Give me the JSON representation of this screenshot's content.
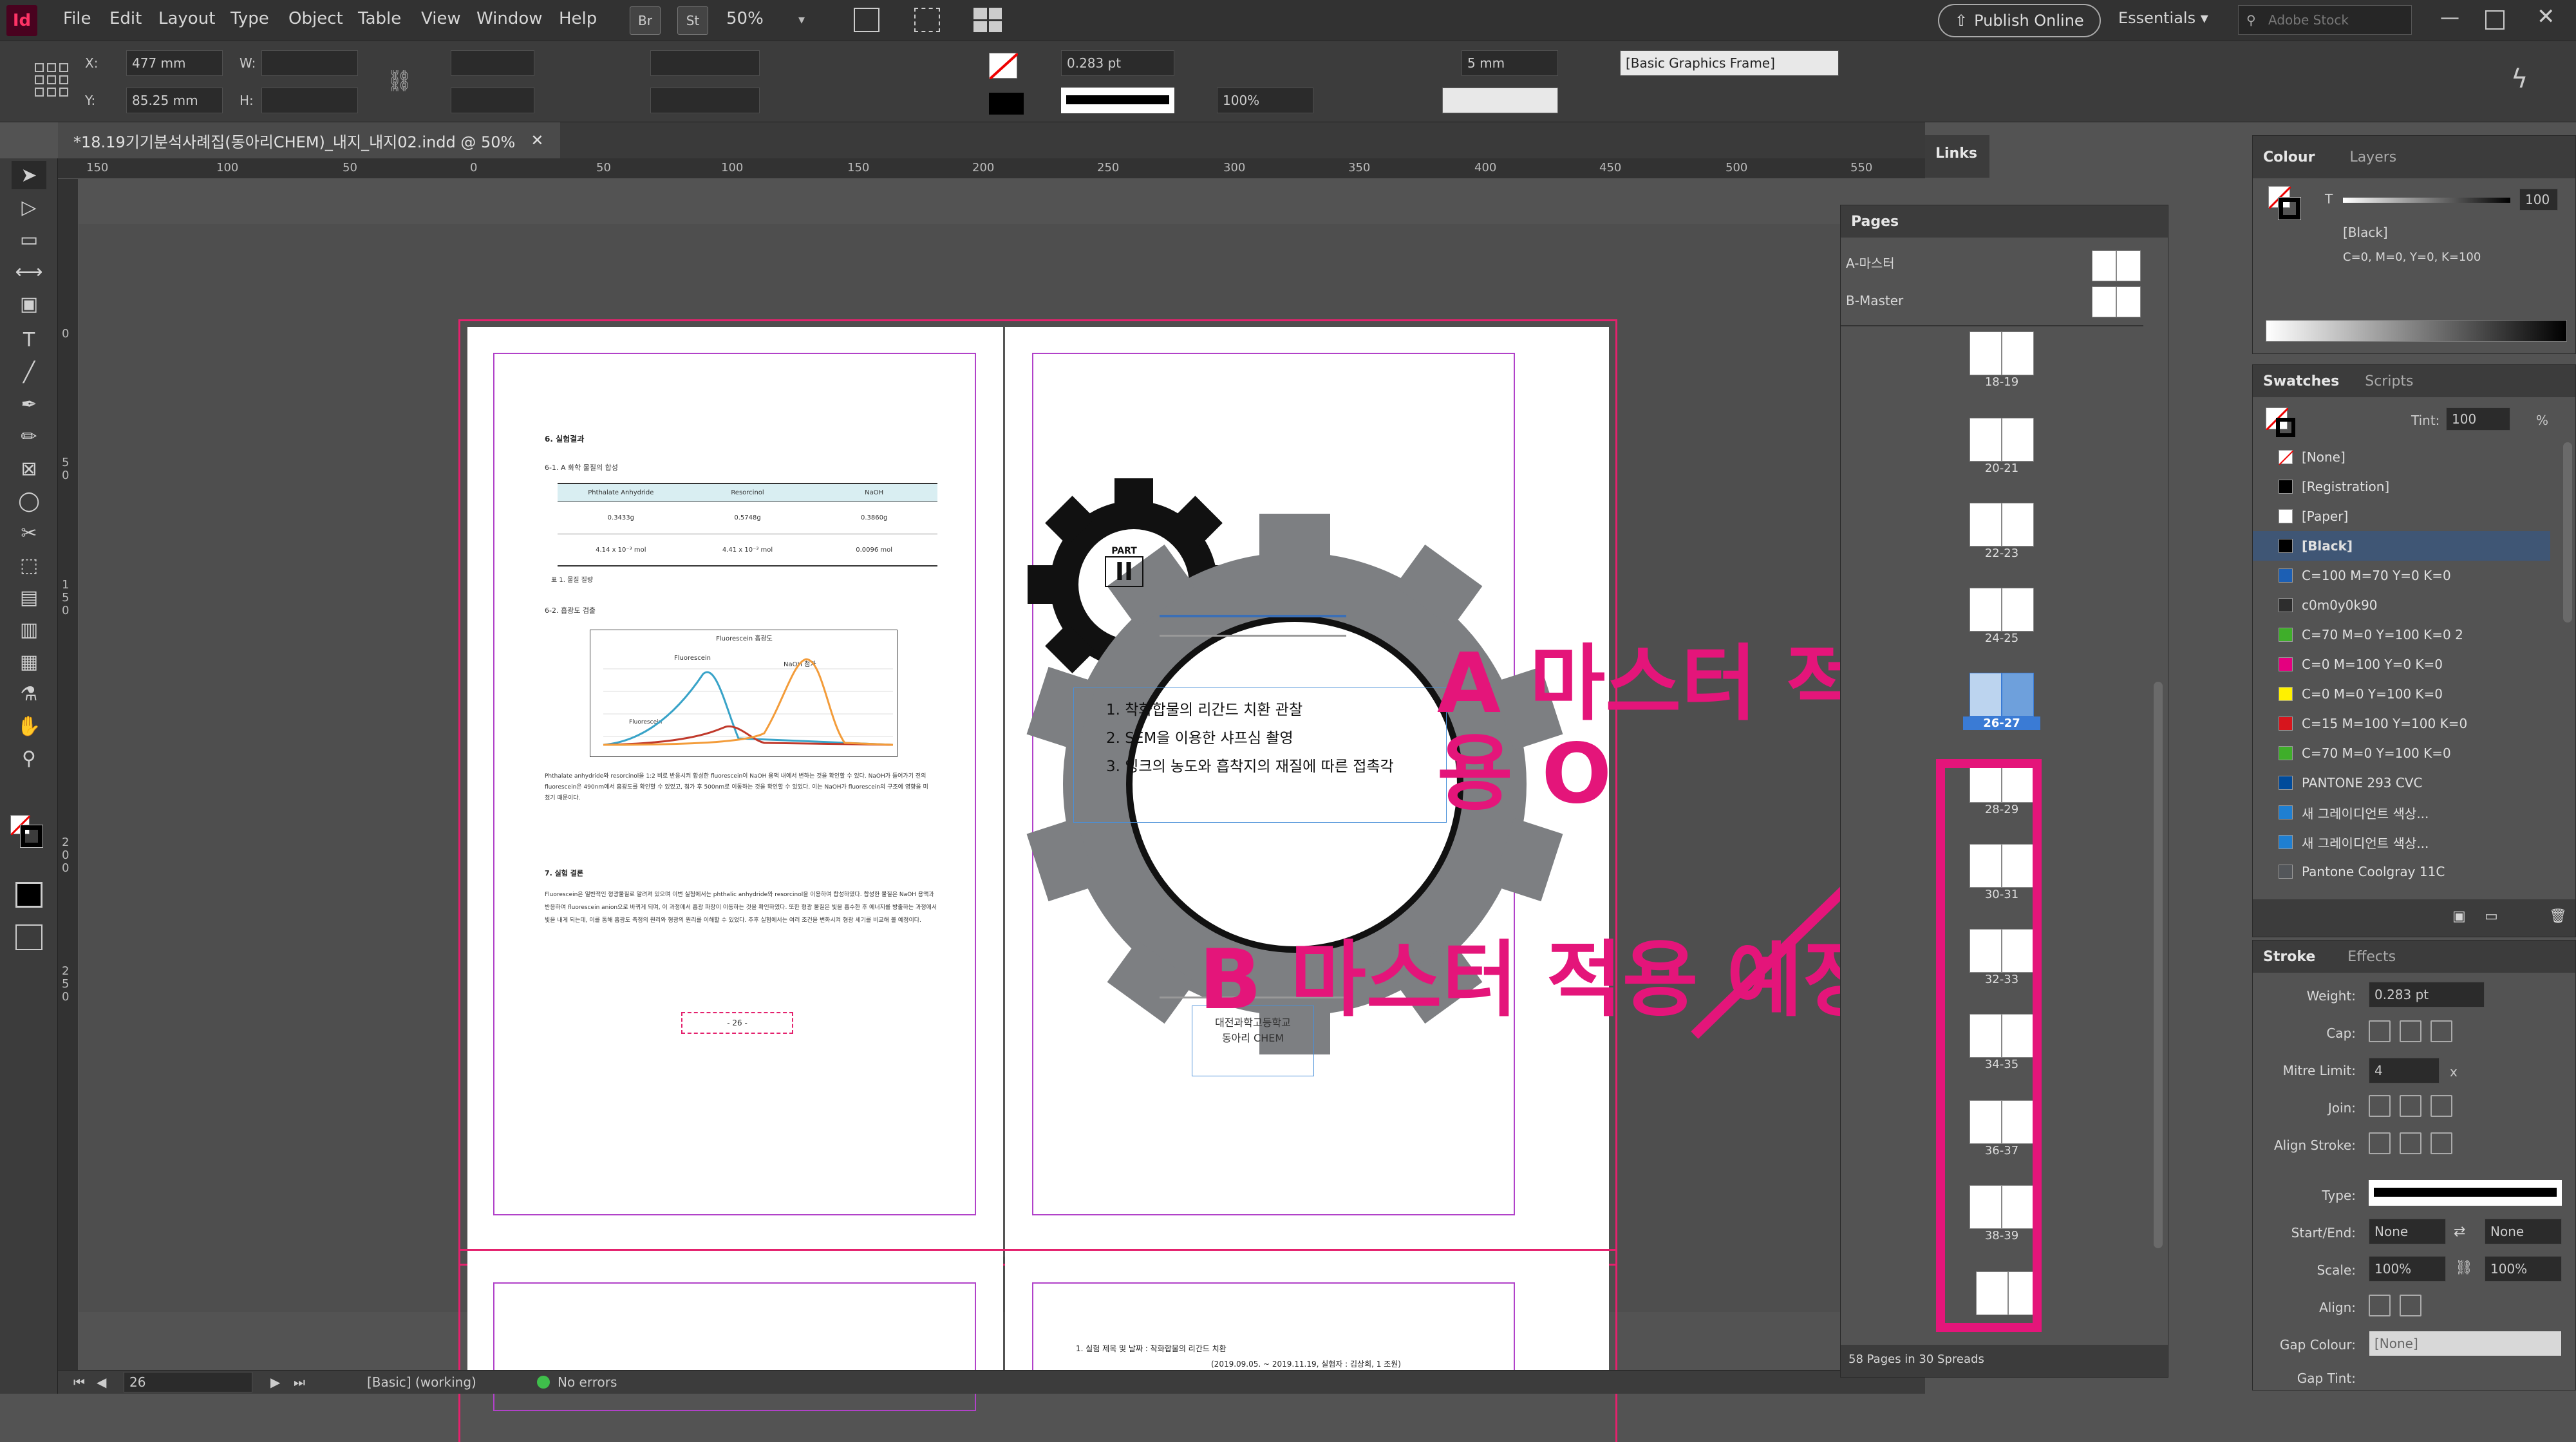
{
  "app": {
    "icon_label": "Id"
  },
  "menu": [
    "File",
    "Edit",
    "Layout",
    "Type",
    "Object",
    "Table",
    "View",
    "Window",
    "Help"
  ],
  "menubar": {
    "bridge": "Br",
    "stock": "St",
    "zoom": "50%",
    "publish": "Publish Online",
    "workspace": "Essentials",
    "search_placeholder": "Adobe Stock"
  },
  "control": {
    "x_label": "X:",
    "x_value": "477 mm",
    "y_label": "Y:",
    "y_value": "85.25 mm",
    "w_label": "W:",
    "h_label": "H:",
    "stroke_weight": "0.283 pt",
    "scale_value": "100%",
    "offset_value": "5 mm",
    "object_style": "[Basic Graphics Frame]"
  },
  "document_tab": "*18.19기기분석사례집(동아리CHEM)_내지_내지02.indd @ 50%",
  "ruler": [
    "150",
    "100",
    "50",
    "0",
    "50",
    "100",
    "150",
    "200",
    "250",
    "300",
    "350",
    "400",
    "450",
    "500",
    "550"
  ],
  "vruler": [
    "0",
    "5",
    "0",
    "1",
    "5",
    "0",
    "2",
    "0",
    "0",
    "2",
    "5",
    "0"
  ],
  "spread": {
    "left_page": {
      "h1": "6. 실험결과",
      "h1_1": "6-1. A 화학 물질의 합성",
      "table_head": [
        "Phthalate Anhydride",
        "Resorcinol",
        "NaOH"
      ],
      "table_row1": [
        "0.3433g",
        "0.5748g",
        "0.3860g"
      ],
      "table_row2": [
        "4.14 x 10⁻³ mol",
        "4.41 x 10⁻³ mol",
        "0.0096 mol"
      ],
      "table_caption": "표 1. 물질 질량",
      "h1_2": "6-2. 흡광도 검출",
      "chart_title": "Fluorescein 흡광도",
      "legend_a": "Fluorescein",
      "legend_b": "NaOH 첨가",
      "legend_c": "Fluorescein",
      "para1": "Phthalate anhydride와 resorcinol을 1:2 비로 반응시켜 합성한 fluorescein이 NaOH 용액 내에서 변하는 것을 확인할 수 있다. NaOH가 들어가기 전의 fluorescein은 490nm에서 흡광도를 확인할 수 있었고, 첨가 후 500nm로 이동하는 것을 확인할 수 있었다. 이는 NaOH가 fluorescein의 구조에 영향을 미쳤기 때문이다.",
      "h2": "7. 실험 결론",
      "para2": "Fluorescein은 일반적인 형광물질로 알려져 있으며 이번 실험에서는 phthalic anhydride와 resorcinol을 이용하여 합성하였다. 합성한 물질은 NaOH 용액과 반응하여 fluorescein anion으로 바뀌게 되며, 이 과정에서 흡광 파장이 이동하는 것을 확인하였다. 또한 형광 물질은 빛을 흡수한 후 에너지를 방출하는 과정에서 빛을 내게 되는데, 이를 통해 흡광도 측정의 원리와 형광의 원리를 이해할 수 있었다. 추후 실험에서는 여러 조건을 변화시켜 형광 세기를 비교해 볼 예정이다.",
      "page_number": "- 26 -"
    },
    "right_page": {
      "part_label": "PART",
      "part_number": "II",
      "item1": "1. 착화합물의 리간드 치환 관찰",
      "item2": "2. SEM을 이용한 샤프심 촬영",
      "item3": "3. 잉크의 농도와 흡착지의 재질에 따른 접촉각",
      "school": "대전과학고등학교",
      "club": "동아리 CHEM"
    }
  },
  "next_spread": {
    "line1": "1. 실험 제목 및 날짜 : 착화합물의 리간드 치환",
    "line2": "(2019.09.05. ~ 2019.11.19, 실험자 : 김상희, 1 조원)"
  },
  "annotations": {
    "a_master": "A 마스터 적용 O",
    "b_master": "B 마스터 적용 예정"
  },
  "links_tab": "Links",
  "pages_panel": {
    "title": "Pages",
    "masters": [
      "A-마스터",
      "B-Master"
    ],
    "spreads": [
      "18-19",
      "20-21",
      "22-23",
      "24-25",
      "26-27",
      "28-29",
      "30-31",
      "32-33",
      "34-35",
      "36-37",
      "38-39"
    ],
    "footer": "58 Pages in 30 Spreads"
  },
  "colour_panel": {
    "tab_colour": "Colour",
    "tab_layers": "Layers",
    "tint_value": "100",
    "swatch_name": "[Black]",
    "cmyk": "C=0, M=0, Y=0, K=100"
  },
  "swatches_panel": {
    "tab_swatches": "Swatches",
    "tab_scripts": "Scripts",
    "tint_label": "Tint:",
    "tint_value": "100",
    "tint_unit": "%",
    "items": [
      {
        "name": "[None]",
        "color": "#ffffff"
      },
      {
        "name": "[Registration]",
        "color": "#000000"
      },
      {
        "name": "[Paper]",
        "color": "#ffffff"
      },
      {
        "name": "[Black]",
        "color": "#000000"
      },
      {
        "name": "C=100 M=70 Y=0 K=0",
        "color": "#1c5fb4"
      },
      {
        "name": "c0m0y0k90",
        "color": "#2d2d2d"
      },
      {
        "name": "C=70 M=0 Y=100 K=0 2",
        "color": "#3fae2a"
      },
      {
        "name": "C=0 M=100 Y=0 K=0",
        "color": "#e4007f"
      },
      {
        "name": "C=0 M=0 Y=100 K=0",
        "color": "#fff100"
      },
      {
        "name": "C=15 M=100 Y=100 K=0",
        "color": "#d7151d"
      },
      {
        "name": "C=70 M=0 Y=100 K=0",
        "color": "#3fae2a"
      },
      {
        "name": "PANTONE 293 CVC",
        "color": "#004b9b"
      },
      {
        "name": "새 그레이디언트 색상...",
        "color": "#1f7fd1"
      },
      {
        "name": "새 그레이디언트 색상...",
        "color": "#1f7fd1"
      },
      {
        "name": "Pantone Coolgray 11C",
        "color": "#53565a"
      }
    ]
  },
  "stroke_panel": {
    "tab_stroke": "Stroke",
    "tab_effects": "Effects",
    "weight_label": "Weight:",
    "weight_value": "0.283 pt",
    "cap_label": "Cap:",
    "mitre_label": "Mitre Limit:",
    "mitre_value": "4",
    "mitre_unit": "x",
    "join_label": "Join:",
    "align_label": "Align Stroke:",
    "type_label": "Type:",
    "startend_label": "Start/End:",
    "start_value": "None",
    "end_value": "None",
    "scale_label": "Scale:",
    "scale1": "100%",
    "scale2": "100%",
    "align2_label": "Align:",
    "gapcolour_label": "Gap Colour:",
    "gapcolour_value": "[None]",
    "gaptint_label": "Gap Tint:"
  },
  "status": {
    "page": "26",
    "style": "[Basic] (working)",
    "errors": "No errors"
  },
  "colors": {
    "accent": "#e4157a",
    "margin": "#b142c9",
    "bleed": "#e4216d",
    "gear": "#7d7f82"
  }
}
